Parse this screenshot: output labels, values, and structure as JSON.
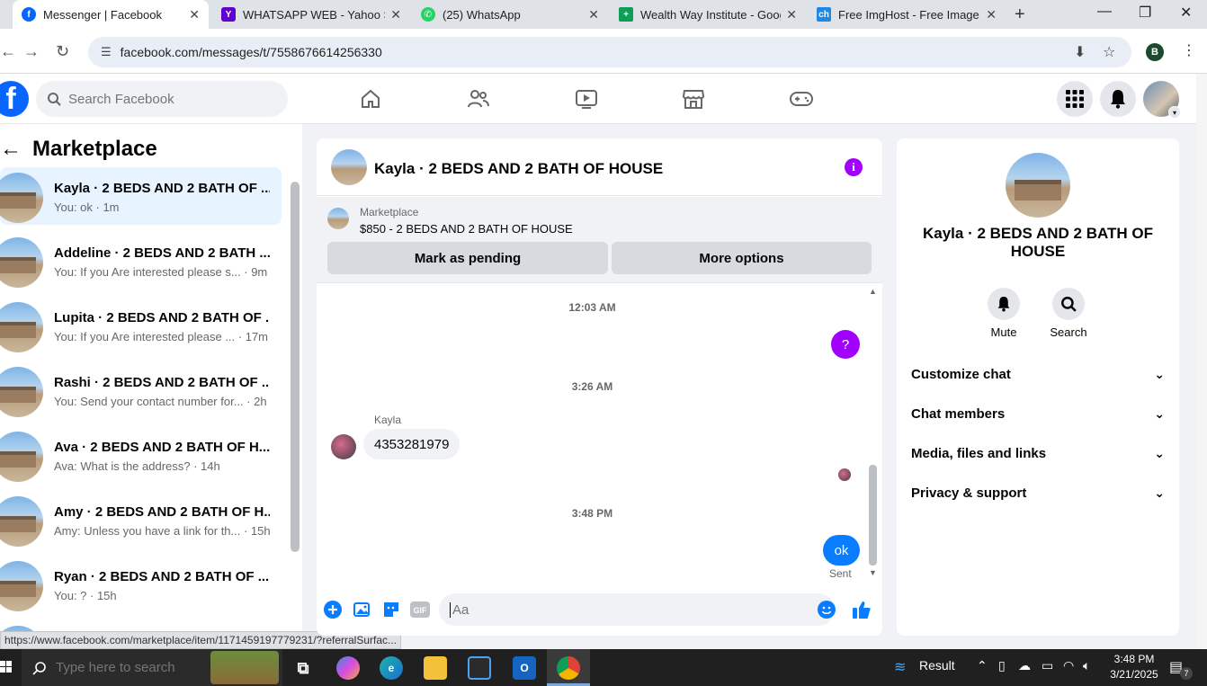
{
  "browser": {
    "tabs": [
      {
        "label": "Messenger | Facebook",
        "favicon": "facebook",
        "active": true
      },
      {
        "label": "WHATSAPP WEB - Yahoo Search",
        "favicon": "yahoo",
        "active": false
      },
      {
        "label": "(25) WhatsApp",
        "favicon": "whatsapp",
        "active": false
      },
      {
        "label": "Wealth Way Institute - Google Sheets",
        "favicon": "sheets",
        "active": false
      },
      {
        "label": "Free ImgHost - Free Image Hosting",
        "favicon": "imghost",
        "active": false
      }
    ],
    "url": "facebook.com/messages/t/7558676614256330",
    "profile_initial": "B",
    "status_url": "https://www.facebook.com/marketplace/item/1171459197779231/?referralSurfac..."
  },
  "fb_nav": {
    "search_placeholder": "Search Facebook"
  },
  "sidebar": {
    "title": "Marketplace",
    "conversations": [
      {
        "name": "Kayla · 2 BEDS AND 2 BATH OF ...",
        "preview": "You: ok · 1m",
        "selected": true
      },
      {
        "name": "Addeline · 2 BEDS AND 2 BATH ...",
        "preview": "You: If you Are interested please s... · 9m",
        "selected": false
      },
      {
        "name": "Lupita · 2 BEDS AND 2 BATH OF ...",
        "preview": "You: If you Are interested please ... · 17m",
        "selected": false
      },
      {
        "name": "Rashi · 2 BEDS AND 2 BATH OF ...",
        "preview": "You: Send your contact number for... · 2h",
        "selected": false
      },
      {
        "name": "Ava · 2 BEDS AND 2 BATH OF H...",
        "preview": "Ava: What is the address? · 14h",
        "selected": false
      },
      {
        "name": "Amy · 2 BEDS AND 2 BATH OF H...",
        "preview": "Amy: Unless you have a link for th... · 15h",
        "selected": false
      },
      {
        "name": "Ryan · 2 BEDS AND 2 BATH OF ...",
        "preview": "You: ? · 15h",
        "selected": false
      }
    ]
  },
  "chat": {
    "title": "Kayla · 2 BEDS AND 2 BATH OF HOUSE",
    "marketplace_label": "Marketplace",
    "listing": "$850 - 2 BEDS AND 2 BATH OF HOUSE",
    "mark_pending": "Mark as pending",
    "more_options": "More options",
    "messages": {
      "ts1": "12:03 AM",
      "out1": "?",
      "ts2": "3:26 AM",
      "sender": "Kayla",
      "in1": "4353281979",
      "ts3": "3:48 PM",
      "out2": "ok",
      "status": "Sent"
    },
    "composer_placeholder": "Aa",
    "accent": "#a100ff"
  },
  "info_panel": {
    "name": "Kayla · 2 BEDS AND 2 BATH OF HOUSE",
    "actions": [
      {
        "label": "Mute",
        "icon": "bell-icon"
      },
      {
        "label": "Search",
        "icon": "search-icon"
      }
    ],
    "sections": [
      "Customize chat",
      "Chat members",
      "Media, files and links",
      "Privacy & support"
    ]
  },
  "taskbar": {
    "search_placeholder": "Type here to search",
    "weather": "Result",
    "time": "3:48 PM",
    "date": "3/21/2025",
    "notif_count": "7"
  }
}
